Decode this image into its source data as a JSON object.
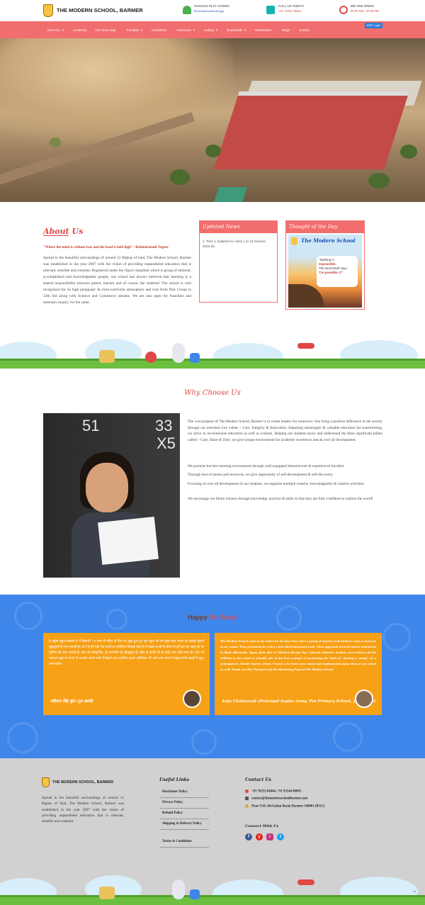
{
  "header": {
    "brand": "THE MODERN SCHOOL, BARMER",
    "app": {
      "line1": "GOOGLE PLAY STORE!",
      "line2": "Download android app"
    },
    "call": {
      "line1": "CALL US TODAY!",
      "line2": "+91 70232 00444"
    },
    "open": {
      "line1": "WE ARE OPEN!",
      "line2": "08.00 AM - 03.00 PM"
    }
  },
  "nav": {
    "items": [
      "About Us",
      "Academic",
      "The Next Leap",
      "Facilities",
      "Guidelines",
      "Admission",
      "Gallery",
      "Downloads",
      "Newsletters",
      "Blogs",
      "Contact"
    ],
    "erp": "ERP Login"
  },
  "about": {
    "title": "About Us",
    "quote": "\"Where the mind is without fear and the head is held high\" ~Rabindranath Tagore",
    "text": "Spread in the beautiful surroundings of around 12 Bighas of land, The Modern School, Barmer was established in the year 2007 with the vision of providing unparalleled education that is relevant, sensible and constant. Registered under the Ojasvi Sansthan which is group of eminent, accomplished and knowledgeable people, our school has always believed that learning is a shared responsibility between parent, teacher and of course, the students! The school is well recognized for its high pedagogic & extra-curricular atmosphere and runs from Play Group to 12th Std along with Science and Commerce streams. We are also open for franchise and entertain enquiry for the same."
  },
  "news": {
    "title": "Updated News",
    "items": [
      "1. Term 1 Syllabus for class 1 to 10 Session 2024-25"
    ]
  },
  "thought": {
    "title": "Thought of the Day",
    "poster_title": "The Modern School",
    "poster_l1": "\"Nothing is",
    "poster_l2": "Impossible.",
    "poster_l3": "The word itself says",
    "poster_l4": "'I'm possible !!'\""
  },
  "why": {
    "title": "Why Choose Us",
    "p1": "The core purpose of The Modern School, Barmer is to create leaders for tomorrow who bring a positive difference in the society through our enriched core values – Care, Integrity & Innovation. Imparting meaningful & valuable education for transforming, we strive to revolutionize education as well as wisdom. Helping our students know and understand the three significant pillars called – Care, Share & Dare, we give unique environment for academic excellence and an over all development.",
    "p2": "We promise the best learning environment through well-equipped infrastructure & experienced faculties",
    "p3": "Through best of means and resources, we give opportunity of self-development & self-discovery",
    "p4": "Focusing on over all development of our students, we organize multiple creative, knowledgeable & creative activities",
    "p5": "We encourage our future citizens through knowledge, practice & skills so that they are fully confident to explore the world!",
    "board": [
      "51",
      "33",
      "X5"
    ]
  },
  "bday": {
    "title_a": "Happy",
    "title_b": "Birthday",
    "card1_text": "हे राष्ट्रीय स्कूल बाड़मेर के ये विद्यार्थी 7-8 साल से पढ़िए के लिए पर जुड़ा हुआ हूं। इस स्कूल की जो मुख्य बात लगता को इसकी पुरानी खूबसूरती से लाभ बनाती है। जो पे है की यहां एक बच्चों का व्यक्तित्व विकास होता है वे लेखक बच्चों के जीवन में पूरी हर एक पहलू को पर पूर्णिमा की तरह जानती है। यहां जो सांस्कृतिक, हो पारंपरिक हो सीखनुमा हो, खेल हो संगीत हो या कोई अन्य कोई कला हो। और जो प्यारदार कुछ तो बनाने में आपको अपने सभी में दिखने वाल उत्पीयों। इसके अतिरिक्त भी आने वाले समय में स्कूल सभी पहलों मैं बहुत आगे बढ़ेगा।",
    "card1_sig": "महिपाल सिंह चुंडा (पुत्र उद्यमी)",
    "card2_text": "The Modern School came to my notice for the first time when a group of teachers and students came to meet me in my school. They presented me with a card which harnessed seeds. Their approach towards nature enticed me to think differently. Again, their idea of 'Mothers Recipe Day' wherein volunteer mothers serve food to all the children in the school is actually one of the best example of inculcating the habit of 'sharing is caring'. As a principal of a Kinder Garten school, I learnt a lot from your school and implemented many ideas in my school as well. Thank you Mrs Pachauri and the Mentoring Team of The Modern School",
    "card2_sig": "Anju Chaturvedi (Principal Sapler Army, Pre Primary School, Jaisalmer)"
  },
  "footer": {
    "brand": "THE MODERN SCHOOL, BARMER",
    "about": "Spread in the beautiful surroundings of around 12 Bighas of land, The Modern School, Barmer was established in the year 2007 with the vision of providing unparalleled education that is relevant, sensible and constant.",
    "links_title": "Useful Links",
    "links": [
      "Disclaimer Policy",
      "Privacy Policy",
      "Refund Policy",
      "Shipping & Delivery Policy",
      "Terms & Conditions"
    ],
    "contact_title": "Contact Us",
    "phone": "+91 70232 00444,  +91 92144 06895",
    "email": "contact@themodernschoolbarmer.com",
    "address": "Near N.H.-68,Gadan Road, Barmer-344001 (RAJ.)",
    "connect": "Connect With Us",
    "social": [
      "f",
      "y",
      "i",
      "t"
    ],
    "social_colors": [
      "#3b5998",
      "#e62117",
      "#c13584",
      "#1da1f2"
    ]
  }
}
